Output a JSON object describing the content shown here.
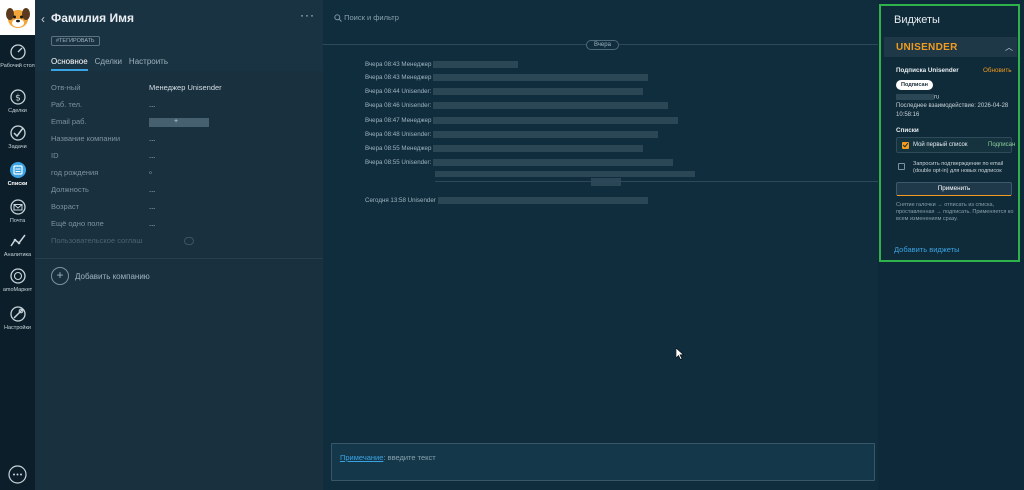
{
  "nav": {
    "items": [
      {
        "label": "Рабочий стол",
        "icon": "dashboard-icon"
      },
      {
        "label": "Сделки",
        "icon": "deals-icon"
      },
      {
        "label": "Задачи",
        "icon": "tasks-icon"
      },
      {
        "label": "Списки",
        "icon": "lists-icon",
        "active": true
      },
      {
        "label": "Почта",
        "icon": "mail-icon"
      },
      {
        "label": "Аналитика",
        "icon": "analytics-icon"
      },
      {
        "label": "amoМаркет",
        "icon": "market-icon"
      },
      {
        "label": "Настройки",
        "icon": "settings-icon"
      }
    ]
  },
  "contact": {
    "name": "Фамилия Имя",
    "tag_label": "#ТЕГИРОВАТЬ",
    "tabs": [
      {
        "label": "Основное",
        "active": true
      },
      {
        "label": "Сделки"
      },
      {
        "label": "Настроить"
      }
    ],
    "fields": [
      {
        "label": "Отв-ный",
        "value": "Менеджер Unisender"
      },
      {
        "label": "Раб. тел.",
        "value": "..."
      },
      {
        "label": "Email раб.",
        "value": ""
      },
      {
        "label": "Название компании",
        "value": "..."
      },
      {
        "label": "ID",
        "value": "..."
      },
      {
        "label": "год рождения",
        "value": ""
      },
      {
        "label": "Должность",
        "value": "..."
      },
      {
        "label": "Возраст",
        "value": "..."
      },
      {
        "label": "Ещё одно поле",
        "value": "..."
      },
      {
        "label": "Пользовательское соглаш",
        "value": ""
      }
    ],
    "add_company": "Добавить компанию"
  },
  "feed": {
    "search_placeholder": "Поиск и фильтр",
    "date_pill": "Вчера",
    "events": [
      "Вчера 08:43 Менеджер",
      "Вчера 08:43 Менеджер",
      "Вчера 08:44 Unisender:",
      "Вчера 08:46 Unisender:",
      "Вчера 08:47 Менеджер",
      "Вчера 08:48 Unisender:",
      "Вчера 08:55 Менеджер",
      "Вчера 08:55 Unisender:"
    ],
    "today_event": "Сегодня 13:58 Unisender",
    "note_label": "Примечание",
    "note_placeholder": ": введите текст"
  },
  "widgets": {
    "title": "Виджеты",
    "unisender": {
      "logo": "UNISENDER",
      "subscription_title": "Подписка Unisender",
      "refresh": "Обновить",
      "status_badge": "Подписан",
      "email_suffix": "ru",
      "last_interaction": "Последнее взаимодействие: 2026-04-28 10:58:16",
      "lists_title": "Списки",
      "list_name": "Мой первый список",
      "list_status": "Подписан",
      "confirm_text": "Запросить подтверждение по email (double opt-in) для новых подписок",
      "apply_label": "Применить",
      "hint": "Снятие галочки → отписать из списка, проставленная → подписать. Применяется ко всем изменениям сразу."
    },
    "add_widgets": "Добавить виджеты"
  },
  "colors": {
    "accent": "#3aa3e3",
    "unisender_orange": "#f29c1f",
    "highlight_border": "#2db34a"
  }
}
